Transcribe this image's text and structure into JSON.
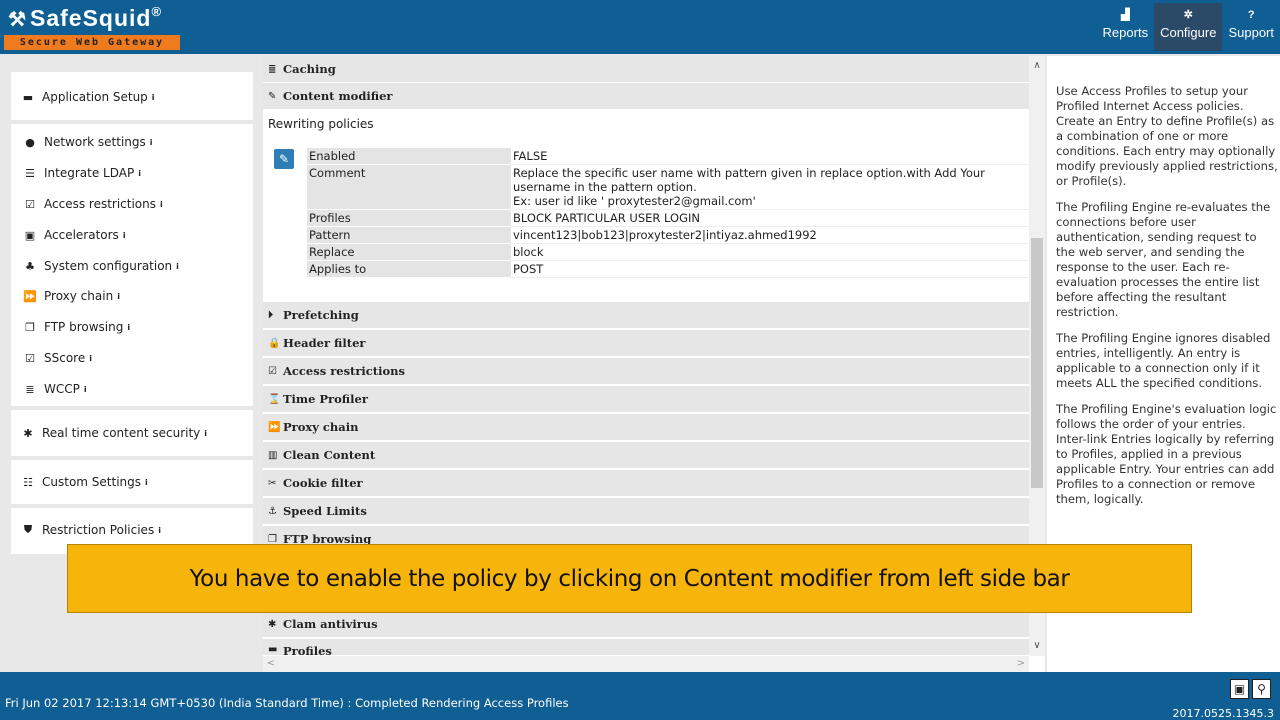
{
  "app": {
    "name": "SafeSquid",
    "registered": "®",
    "tagline": "Secure Web Gateway"
  },
  "nav": [
    {
      "label": "Reports",
      "icon": "chart-icon",
      "glyph": "▟"
    },
    {
      "label": "Configure",
      "icon": "cogs-icon",
      "glyph": "✲"
    },
    {
      "label": "Support",
      "icon": "question-icon",
      "glyph": "?"
    }
  ],
  "sidebar": {
    "info_glyph": "i",
    "items": [
      {
        "label": "Application Setup",
        "icon": "briefcase-icon",
        "glyph": "▬"
      },
      {
        "label": "Network settings",
        "icon": "globe-icon",
        "glyph": "●"
      },
      {
        "label": "Integrate LDAP",
        "icon": "list-icon",
        "glyph": "☰"
      },
      {
        "label": "Access restrictions",
        "icon": "check-square-icon",
        "glyph": "☑"
      },
      {
        "label": "Accelerators",
        "icon": "train-icon",
        "glyph": "▣"
      },
      {
        "label": "System configuration",
        "icon": "sitemap-icon",
        "glyph": "♣"
      },
      {
        "label": "Proxy chain",
        "icon": "forward-icon",
        "glyph": "⏩"
      },
      {
        "label": "FTP browsing",
        "icon": "copy-icon",
        "glyph": "❐"
      },
      {
        "label": "SScore",
        "icon": "check-square-icon",
        "glyph": "☑"
      },
      {
        "label": "WCCP",
        "icon": "server-icon",
        "glyph": "≣"
      },
      {
        "label": "Real time content security",
        "icon": "bug-icon",
        "glyph": "✱"
      },
      {
        "label": "Custom Settings",
        "icon": "sliders-icon",
        "glyph": "☷"
      },
      {
        "label": "Restriction Policies",
        "icon": "shield-icon",
        "glyph": "⛊"
      }
    ]
  },
  "main": {
    "sections_top": [
      {
        "label": "Caching",
        "icon": "server-icon",
        "glyph": "≣"
      },
      {
        "label": "Content modifier",
        "icon": "edit-icon",
        "glyph": "✎"
      }
    ],
    "rewrite_title": "Rewriting policies",
    "edit_glyph": "✎",
    "entry": [
      {
        "key": "Enabled",
        "value": "FALSE"
      },
      {
        "key": "Comment",
        "value_lines": [
          "Replace the specific user name with pattern given in replace option.with Add Your username in the pattern option.",
          "Ex: user id like ' proxytester2@gmail.com'"
        ]
      },
      {
        "key": "Profiles",
        "value": "BLOCK PARTICULAR USER LOGIN"
      },
      {
        "key": "Pattern",
        "value": "vincent123|bob123|proxytester2|intiyaz.ahmed1992"
      },
      {
        "key": "Replace",
        "value": "block"
      },
      {
        "key": "Applies to",
        "value": "POST"
      }
    ],
    "sections_bottom": [
      {
        "label": "Prefetching",
        "icon": "step-forward-icon",
        "glyph": "⏵"
      },
      {
        "label": "Header filter",
        "icon": "lock-icon",
        "glyph": "🔒"
      },
      {
        "label": "Access restrictions",
        "icon": "check-square-icon",
        "glyph": "☑"
      },
      {
        "label": "Time Profiler",
        "icon": "hourglass-icon",
        "glyph": "⌛"
      },
      {
        "label": "Proxy chain",
        "icon": "forward-icon",
        "glyph": "⏩"
      },
      {
        "label": "Clean Content",
        "icon": "barcode-icon",
        "glyph": "▥"
      },
      {
        "label": "Cookie filter",
        "icon": "scissors-icon",
        "glyph": "✂"
      },
      {
        "label": "Speed Limits",
        "icon": "anchor-icon",
        "glyph": "⚓"
      },
      {
        "label": "FTP browsing",
        "icon": "copy-icon",
        "glyph": "❐"
      },
      {
        "label": "Clam antivirus",
        "icon": "asterisk-icon",
        "glyph": "✱"
      },
      {
        "label": "Profiles",
        "icon": "briefcase-icon",
        "glyph": "▬"
      }
    ]
  },
  "help": {
    "paragraphs": [
      "Use Access Profiles to setup your Profiled Internet Access policies. Create an Entry to define Profile(s) as a combination of one or more conditions. Each entry may optionally modify previously applied restrictions, or Profile(s).",
      "The Profiling Engine re-evaluates the connections before user authentication, sending request to the web server, and sending the response to the user. Each re-evaluation processes the entire list before affecting the resultant restriction.",
      "The Profiling Engine ignores disabled entries, intelligently. An entry is applicable to a connection only if it meets ALL the specified conditions.",
      "The Profiling Engine's evaluation logic follows the order of your entries. Inter-link Entries logically by referring to Profiles, applied in a previous applicable Entry. Your entries can add Profiles to a connection or remove them, logically."
    ]
  },
  "banner": {
    "text": "You have to enable the policy by clicking on Content modifier from left side bar"
  },
  "footer": {
    "status": "Fri Jun 02 2017 12:13:14 GMT+0530 (India Standard Time) : Completed Rendering Access Profiles",
    "version": "2017.0525.1345.3",
    "save_glyph": "💾",
    "search_glyph": "🔍"
  },
  "colors": {
    "header_bg": "#0f5f94",
    "active_nav": "#2b4a68",
    "tagline_bg": "#f07b1e",
    "banner_bg": "#f7b50b",
    "edit_button": "#2f7db7"
  }
}
